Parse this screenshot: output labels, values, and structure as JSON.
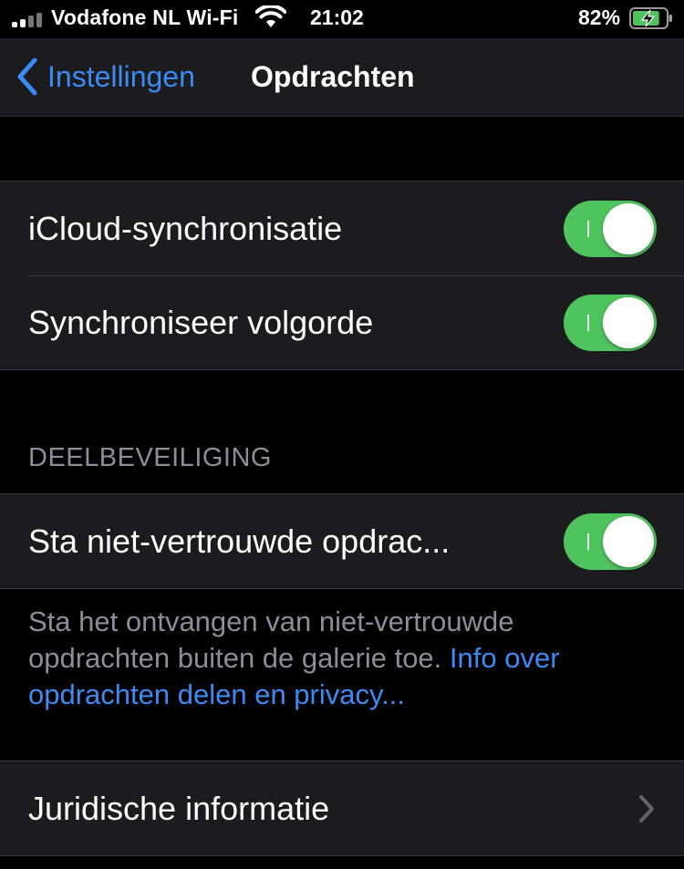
{
  "status_bar": {
    "carrier": "Vodafone NL Wi-Fi",
    "time": "21:02",
    "battery_percent": "82%",
    "battery_level": 0.82
  },
  "nav": {
    "back_label": "Instellingen",
    "title": "Opdrachten"
  },
  "sync_group": {
    "icloud_label": "iCloud-synchronisatie",
    "icloud_on": true,
    "order_label": "Synchroniseer volgorde",
    "order_on": true
  },
  "share_security": {
    "header": "DEELBEVEILIGING",
    "untrusted_label": "Sta niet-vertrouwde opdrac...",
    "untrusted_on": true,
    "footer_text": "Sta het ontvangen van niet-vertrouwde opdrachten buiten de galerie toe. ",
    "footer_link": "Info over opdrachten delen en privacy..."
  },
  "legal": {
    "label": "Juridische informatie"
  },
  "colors": {
    "accent_blue": "#3c8bf5",
    "toggle_green": "#4fc35d",
    "cell_background": "#1c1c1e"
  }
}
